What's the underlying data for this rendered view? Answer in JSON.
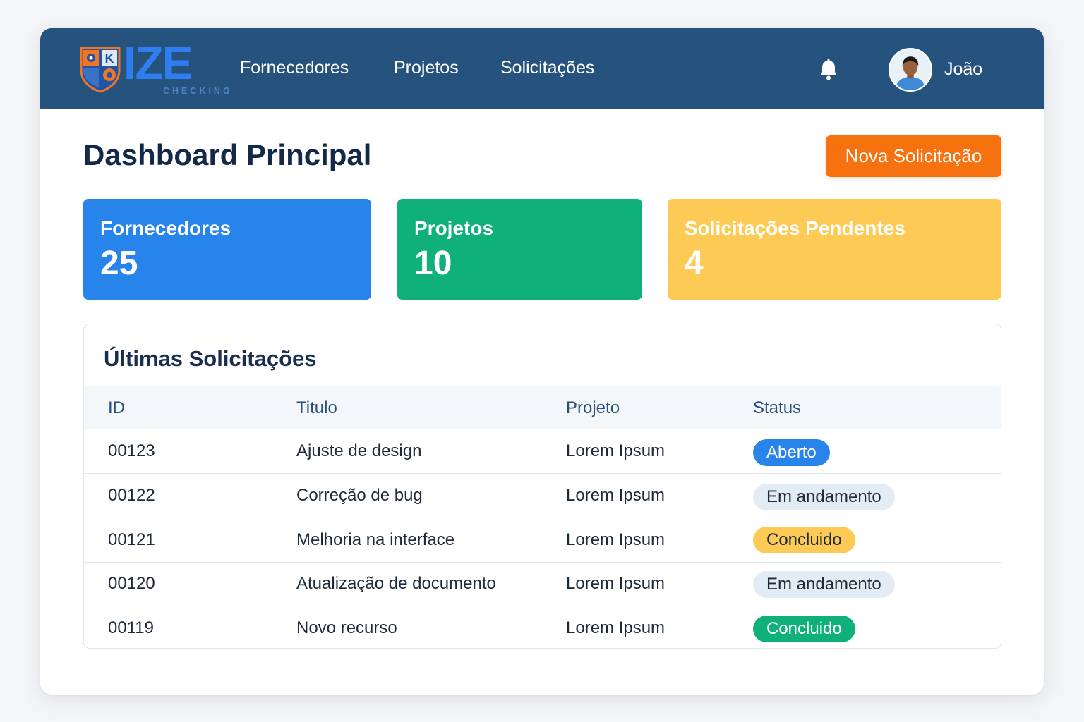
{
  "brand": {
    "name": "IZE",
    "tagline": "CHECKING",
    "emblem_letter": "K"
  },
  "nav": {
    "items": [
      "Fornecedores",
      "Projetos",
      "Solicitações"
    ]
  },
  "user": {
    "name": "João"
  },
  "icons": {
    "notifications": "bell-icon",
    "profile": "avatar"
  },
  "page": {
    "title": "Dashboard Principal",
    "primary_action": "Nova Solicitação"
  },
  "stats": [
    {
      "label": "Fornecedores",
      "value": "25",
      "color": "#2784ea"
    },
    {
      "label": "Projetos",
      "value": "10",
      "color": "#0fb07a"
    },
    {
      "label": "Solicitações Pendentes",
      "value": "4",
      "color": "#fdcb55"
    }
  ],
  "requests": {
    "title": "Últimas Solicitações",
    "columns": [
      "ID",
      "Titulo",
      "Projeto",
      "Status"
    ],
    "rows": [
      {
        "id": "00123",
        "title": "Ajuste de design",
        "project": "Lorem Ipsum",
        "status": "Aberto",
        "status_bg": "#2784ea",
        "status_fg": "#ffffff"
      },
      {
        "id": "00122",
        "title": "Correção de bug",
        "project": "Lorem Ipsum",
        "status": "Em andamento",
        "status_bg": "#e3ebf4",
        "status_fg": "#1d2a3a"
      },
      {
        "id": "00121",
        "title": "Melhoria na interface",
        "project": "Lorem Ipsum",
        "status": "Concluido",
        "status_bg": "#fdcb55",
        "status_fg": "#1d2a3a"
      },
      {
        "id": "00120",
        "title": "Atualização de documento",
        "project": "Lorem Ipsum",
        "status": "Em andamento",
        "status_bg": "#e3ebf4",
        "status_fg": "#1d2a3a"
      },
      {
        "id": "00119",
        "title": "Novo recurso",
        "project": "Lorem Ipsum",
        "status": "Concluido",
        "status_bg": "#0fb07a",
        "status_fg": "#ffffff"
      }
    ]
  }
}
